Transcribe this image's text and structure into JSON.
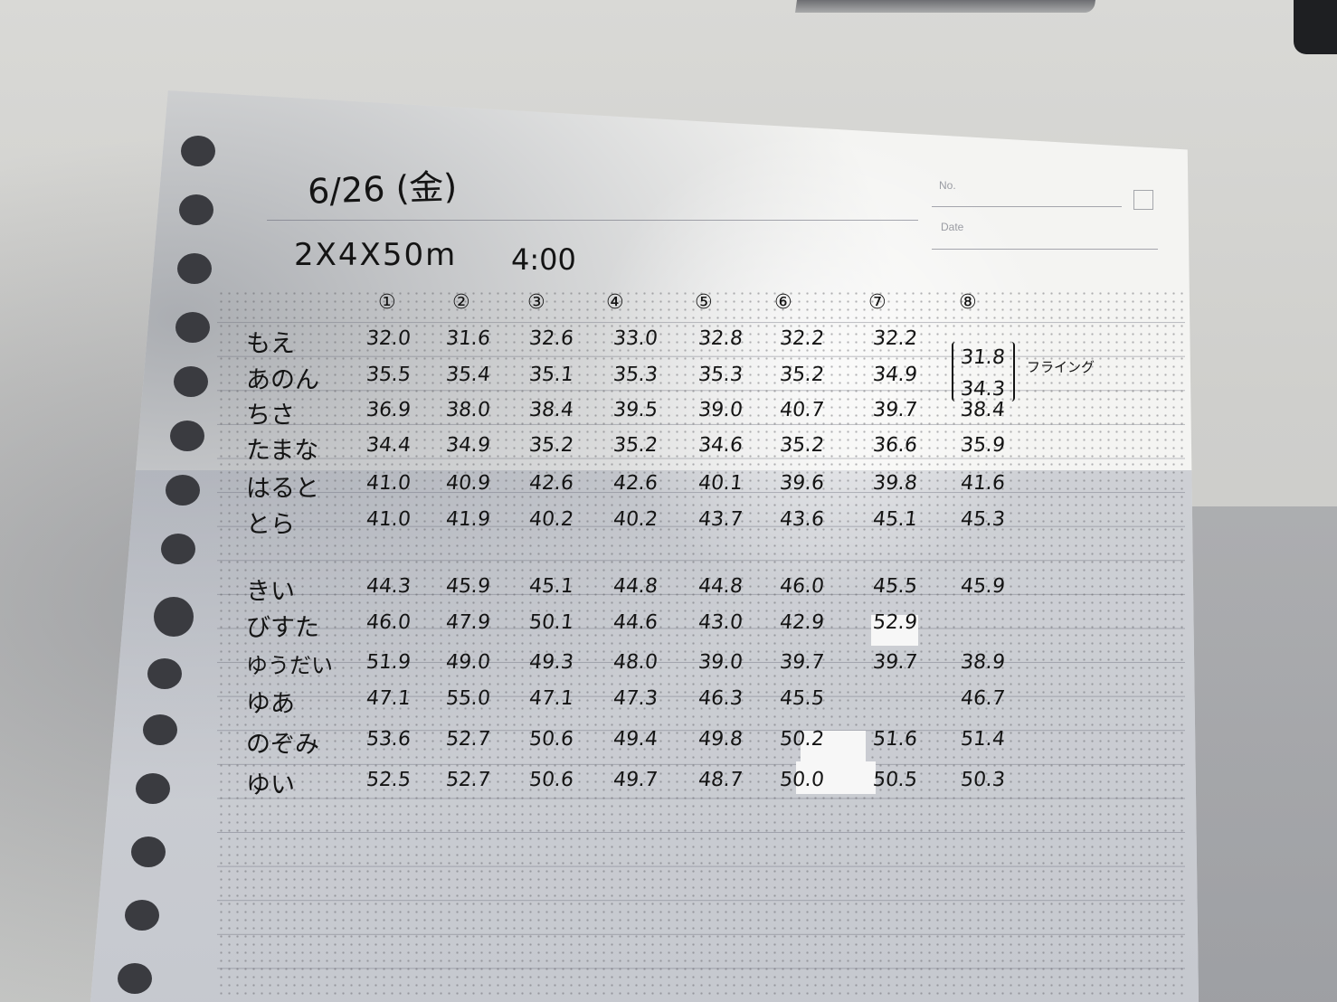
{
  "header": {
    "date": "6/26 (金)",
    "set": "2X4X50m",
    "cycle": "4:00",
    "no_label": "No.",
    "date_label": "Date"
  },
  "columns": [
    "①",
    "②",
    "③",
    "④",
    "⑤",
    "⑥",
    "⑦",
    "⑧"
  ],
  "group1": [
    {
      "name": "もえ",
      "times": [
        "32.0",
        "31.6",
        "32.6",
        "33.0",
        "32.8",
        "32.2",
        "32.2",
        "31.8"
      ]
    },
    {
      "name": "あのん",
      "times": [
        "35.5",
        "35.4",
        "35.1",
        "35.3",
        "35.3",
        "35.2",
        "34.9",
        "34.3"
      ]
    },
    {
      "name": "ちさ",
      "times": [
        "36.9",
        "38.0",
        "38.4",
        "39.5",
        "39.0",
        "40.7",
        "39.7",
        "38.4"
      ]
    },
    {
      "name": "たまな",
      "times": [
        "34.4",
        "34.9",
        "35.2",
        "35.2",
        "34.6",
        "35.2",
        "36.6",
        "35.9"
      ]
    },
    {
      "name": "はると",
      "times": [
        "41.0",
        "40.9",
        "42.6",
        "42.6",
        "40.1",
        "39.6",
        "39.8",
        "41.6"
      ]
    },
    {
      "name": "とら",
      "times": [
        "41.0",
        "41.9",
        "40.2",
        "40.2",
        "43.7",
        "43.6",
        "45.1",
        "45.3"
      ]
    }
  ],
  "group2": [
    {
      "name": "きい",
      "times": [
        "44.3",
        "45.9",
        "45.1",
        "44.8",
        "44.8",
        "46.0",
        "45.5",
        "45.9"
      ]
    },
    {
      "name": "びすた",
      "times": [
        "46.0",
        "47.9",
        "50.1",
        "44.6",
        "43.0",
        "42.9",
        "52.9",
        ""
      ]
    },
    {
      "name": "ゆうだい",
      "times": [
        "51.9",
        "49.0",
        "49.3",
        "48.0",
        "39.0",
        "39.7",
        "39.7",
        "38.9"
      ]
    },
    {
      "name": "ゆあ",
      "times": [
        "47.1",
        "55.0",
        "47.1",
        "47.3",
        "46.3",
        "45.5",
        "",
        "46.7"
      ]
    },
    {
      "name": "のぞみ",
      "times": [
        "53.6",
        "52.7",
        "50.6",
        "49.4",
        "49.8",
        "50.2",
        "51.6",
        "51.4"
      ]
    },
    {
      "name": "ゆい",
      "times": [
        "52.5",
        "52.7",
        "50.6",
        "49.7",
        "48.7",
        "50.0",
        "50.5",
        "50.3"
      ]
    }
  ],
  "note": "フライング"
}
